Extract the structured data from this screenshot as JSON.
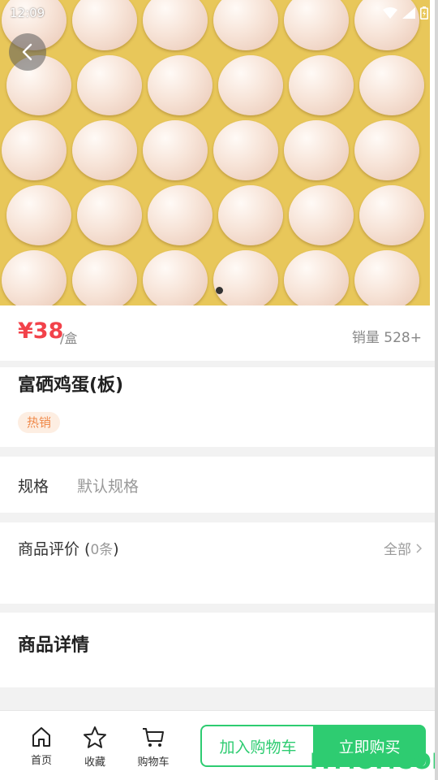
{
  "status_bar": {
    "time": "12:09"
  },
  "product": {
    "price": "¥38",
    "price_unit": "/盒",
    "sales": "销量 528+",
    "name": "富硒鸡蛋(板)",
    "tag": "热销"
  },
  "spec": {
    "label": "规格",
    "value": "默认规格"
  },
  "reviews": {
    "title_prefix": "商品评价 (",
    "count": "0条",
    "title_suffix": ")",
    "all_label": "全部"
  },
  "details": {
    "title": "商品详情"
  },
  "bottom_nav": {
    "home": "首页",
    "favorite": "收藏",
    "cart": "购物车"
  },
  "actions": {
    "add_to_cart": "加入购物车",
    "buy_now": "立即购买"
  },
  "watermark": "ITMOP.COM",
  "colors": {
    "price": "#f2424a",
    "accent_green": "#2ecc71",
    "tag_text": "#f08a4b",
    "tag_bg": "#fdeee2"
  },
  "carousel": {
    "current_slide": 1,
    "total_slides": 1
  }
}
